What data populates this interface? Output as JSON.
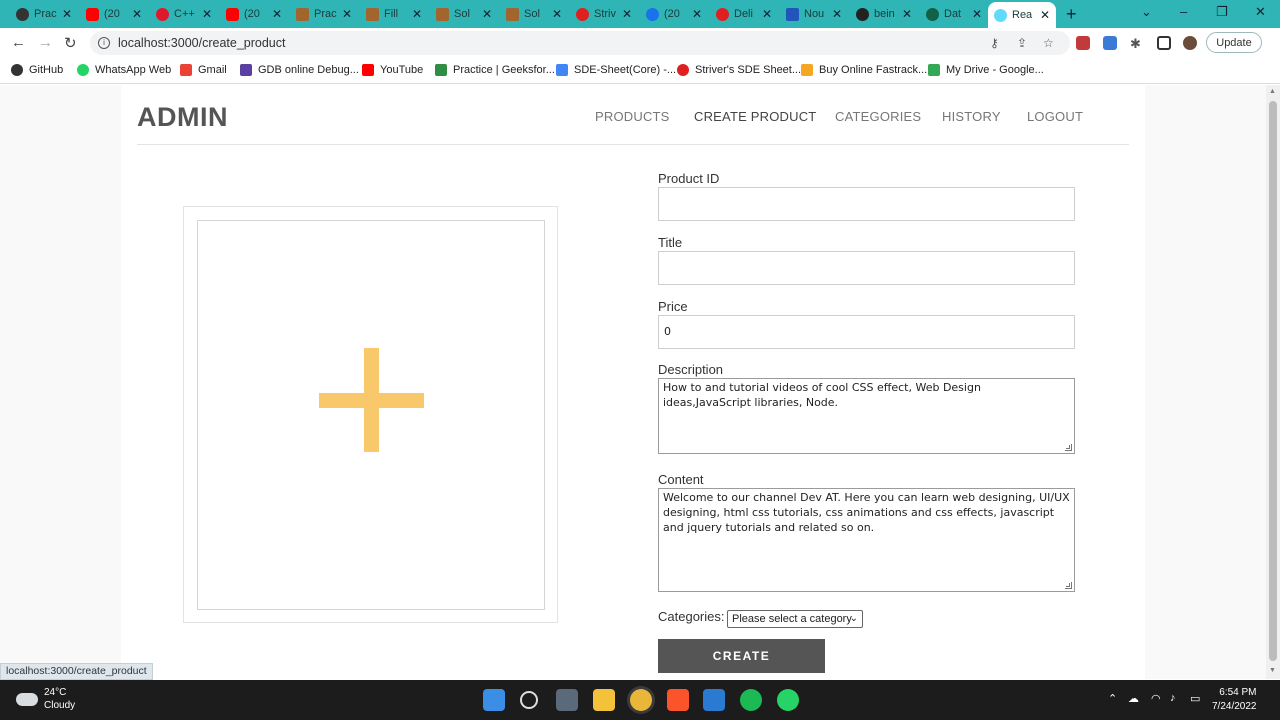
{
  "browser": {
    "tabs": [
      {
        "label": "Prac",
        "color": "#333333"
      },
      {
        "label": "(20",
        "color": "#ff0000"
      },
      {
        "label": "C++",
        "color": "#e0182d"
      },
      {
        "label": "(20",
        "color": "#ff0000"
      },
      {
        "label": "Prac",
        "color": "#a0662e"
      },
      {
        "label": "Fill",
        "color": "#a0662e"
      },
      {
        "label": "Sol",
        "color": "#a0662e"
      },
      {
        "label": "Sol",
        "color": "#a0662e"
      },
      {
        "label": "Striv",
        "color": "#e02020"
      },
      {
        "label": "(20",
        "color": "#1a73e8"
      },
      {
        "label": "Deli",
        "color": "#e02020"
      },
      {
        "label": "Nou",
        "color": "#2255bb"
      },
      {
        "label": "bein",
        "color": "#222222"
      },
      {
        "label": "Dat",
        "color": "#116149"
      },
      {
        "label": "Rea",
        "color": "#61dafb",
        "active": true
      }
    ],
    "url": "localhost:3000/create_product",
    "update_label": "Update",
    "bookmarks": [
      {
        "label": "GitHub",
        "color": "#333333"
      },
      {
        "label": "WhatsApp Web",
        "color": "#25d366"
      },
      {
        "label": "Gmail",
        "color": "#ea4335"
      },
      {
        "label": "GDB online Debug...",
        "color": "#5a3fa0"
      },
      {
        "label": "YouTube",
        "color": "#ff0000"
      },
      {
        "label": "Practice | Geeksfor...",
        "color": "#2f8d46"
      },
      {
        "label": "SDE-Sheet(Core) -...",
        "color": "#4285f4"
      },
      {
        "label": "Striver's SDE Sheet...",
        "color": "#e02020"
      },
      {
        "label": "Buy Online Fastrack...",
        "color": "#f5a623"
      },
      {
        "label": "My Drive - Google...",
        "color": "#34a853"
      }
    ],
    "status_url": "localhost:3000/create_product"
  },
  "header": {
    "brand": "ADMIN",
    "nav": [
      {
        "label": "PRODUCTS"
      },
      {
        "label": "CREATE PRODUCT",
        "active": true
      },
      {
        "label": "CATEGORIES"
      },
      {
        "label": "HISTORY"
      },
      {
        "label": "LOGOUT"
      }
    ]
  },
  "upload": {
    "icon": "plus-icon",
    "accent": "#f9c86a"
  },
  "form": {
    "product_id": {
      "label": "Product ID",
      "value": ""
    },
    "title": {
      "label": "Title",
      "value": ""
    },
    "price": {
      "label": "Price",
      "value": "0"
    },
    "description": {
      "label": "Description",
      "value": "How to and tutorial videos of cool CSS effect, Web Design ideas,JavaScript libraries, Node."
    },
    "content": {
      "label": "Content",
      "value": "Welcome to our channel Dev AT. Here you can learn web designing, UI/UX designing, html css tutorials, css animations and css effects, javascript and jquery tutorials and related so on."
    },
    "categories": {
      "label": "Categories:",
      "selected": "Please select a category"
    },
    "submit_label": "CREATE"
  },
  "taskbar": {
    "temperature": "24°C",
    "weather": "Cloudy",
    "time": "6:54 PM",
    "date": "7/24/2022"
  }
}
